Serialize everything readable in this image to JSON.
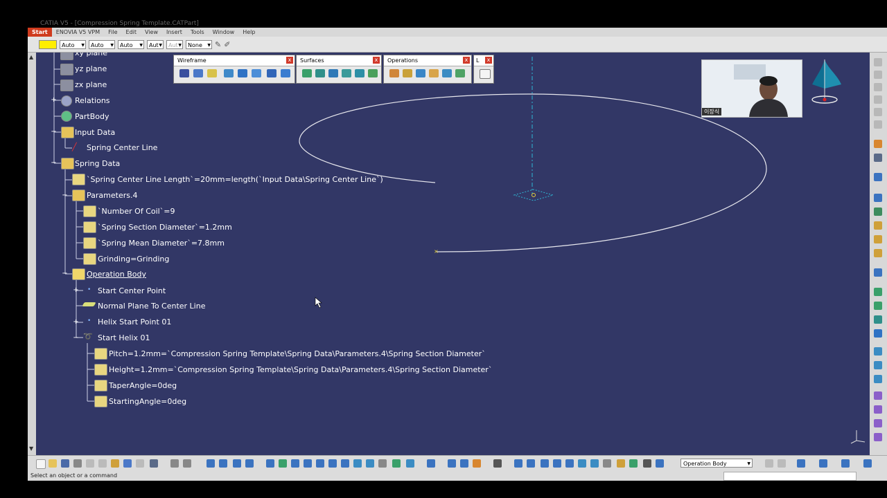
{
  "window": {
    "title": "CATIA V5 - [Compression Spring Template.CATPart]"
  },
  "menu": [
    "Start",
    "ENOVIA V5 VPM",
    "File",
    "Edit",
    "View",
    "Insert",
    "Tools",
    "Window",
    "Help"
  ],
  "properties_bar": {
    "color_swatch": "#ffee00",
    "combo1": "Auto",
    "combo2": "Auto",
    "combo3": "Auto",
    "combo4": "Aut",
    "combo5": "Aut",
    "combo6": "None"
  },
  "tree": [
    {
      "label": "xy plane",
      "icon": "plane-icon"
    },
    {
      "label": "yz plane",
      "icon": "plane-icon"
    },
    {
      "label": "zx plane",
      "icon": "plane-icon"
    },
    {
      "label": "Relations",
      "icon": "relations-icon"
    },
    {
      "label": "PartBody",
      "icon": "gear-icon"
    },
    {
      "label": "Input Data",
      "icon": "geometric-set-icon"
    },
    {
      "label": "Spring Center Line",
      "icon": "line-icon"
    },
    {
      "label": "Spring Data",
      "icon": "geometric-set-icon"
    },
    {
      "label": "`Spring Center Line Length`=20mm=length(`Input Data\\Spring Center Line`)",
      "icon": "formula-icon"
    },
    {
      "label": "Parameters.4",
      "icon": "parameters-icon"
    },
    {
      "label": "`Number Of Coil`=9",
      "icon": "parameter-icon"
    },
    {
      "label": "`Spring Section Diameter`=1.2mm",
      "icon": "parameter-icon"
    },
    {
      "label": "`Spring Mean Diameter`=7.8mm",
      "icon": "parameter-icon"
    },
    {
      "label": "Grinding=Grinding",
      "icon": "parameter-icon"
    },
    {
      "label": "Operation Body",
      "icon": "operation-body-icon"
    },
    {
      "label": "Start Center Point",
      "icon": "point-icon"
    },
    {
      "label": "Normal Plane To Center Line",
      "icon": "plane-icon"
    },
    {
      "label": "Helix Start Point 01",
      "icon": "point-icon"
    },
    {
      "label": "Start Helix 01",
      "icon": "helix-icon"
    },
    {
      "label": "Pitch=1.2mm=`Compression Spring Template\\Spring Data\\Parameters.4\\Spring Section Diameter`",
      "icon": "formula-icon"
    },
    {
      "label": "Height=1.2mm=`Compression Spring Template\\Spring Data\\Parameters.4\\Spring Section Diameter`",
      "icon": "formula-icon"
    },
    {
      "label": "TaperAngle=0deg",
      "icon": "formula-icon"
    },
    {
      "label": "StartingAngle=0deg",
      "icon": "formula-icon"
    }
  ],
  "toolbars": {
    "wireframe": "Wireframe",
    "surfaces": "Surfaces",
    "operations": "Operations",
    "law": "L",
    "close_glyph": "x"
  },
  "webcam": {
    "name": "이장식"
  },
  "bottom": {
    "operation_body_combo": "Operation Body"
  },
  "status": {
    "message": "Select an object or a command"
  },
  "colors": {
    "viewer_background": "#323766",
    "curve": "#e8e8ee",
    "axis": "#2fb7d6"
  }
}
